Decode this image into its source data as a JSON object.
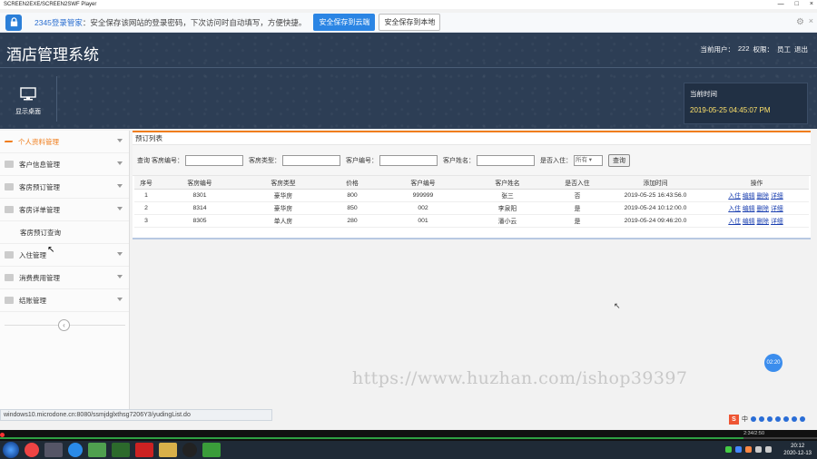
{
  "player": {
    "title": "SCREEN2EXE/SCREEN2SWF Player",
    "controls": [
      "—",
      "□",
      "×"
    ]
  },
  "password_bar": {
    "brand": "2345登录管家",
    "message": "：安全保存该网站的登录密码，下次访问时自动填写，方便快捷。",
    "cloud_button": "安全保存到云端",
    "local_button": "安全保存到本地",
    "close": "×"
  },
  "header": {
    "title": "酒店管理系统",
    "user_label": "当前用户：",
    "user_id": "222",
    "role_label": "权限：",
    "role": "员工",
    "logout": "退出",
    "shortcut_label": "显示桌面",
    "login_time_label": "当前时间",
    "login_time": "2019-05-25 04:45:07 PM"
  },
  "sidebar": {
    "items": [
      {
        "label": "个人资料管理",
        "active": true
      },
      {
        "label": "客户信息管理"
      },
      {
        "label": "客房预订管理"
      },
      {
        "label": "客房详单管理"
      },
      {
        "label": "客房预订查询",
        "sub": true
      },
      {
        "label": "入住管理"
      },
      {
        "label": "消费费用管理"
      },
      {
        "label": "结账管理"
      }
    ],
    "collapse": "‹"
  },
  "panel": {
    "title": "预订列表",
    "search": {
      "prefix": "查询",
      "room_no_label": "客房编号：",
      "room_type_label": "客房类型：",
      "customer_no_label": "客户编号：",
      "customer_name_label": "客户姓名：",
      "checkin_label": "是否入住：",
      "checkin_option": "所有",
      "query_button": "查询"
    },
    "table": {
      "headers": [
        "序号",
        "客房编号",
        "客房类型",
        "价格",
        "客户编号",
        "客户姓名",
        "是否入住",
        "添加时间",
        "操作"
      ],
      "rows": [
        [
          "1",
          "8301",
          "豪华房",
          "800",
          "999999",
          "张三",
          "否",
          "2019-05-25 16:43:56.0"
        ],
        [
          "2",
          "8314",
          "豪华房",
          "850",
          "002",
          "李泉阳",
          "是",
          "2019-05-24 10:12:00.0"
        ],
        [
          "3",
          "8305",
          "单人房",
          "280",
          "001",
          "潘小云",
          "是",
          "2019-05-24 09:46:20.0"
        ]
      ],
      "actions": [
        "入住",
        "编辑",
        "删除",
        "详细"
      ]
    }
  },
  "watermark": "https://www.huzhan.com/ishop39397",
  "timer": "02:20",
  "status_url": "windows10.microdone.cn:8080/ssmjdglxthsg7206Y3/yudingList.do",
  "ime": {
    "mode": "中"
  },
  "progress": {
    "fraction": 0.91,
    "time": "2:34/2:50"
  },
  "tray": {
    "time": "20:12",
    "date": "2020-12-13"
  }
}
